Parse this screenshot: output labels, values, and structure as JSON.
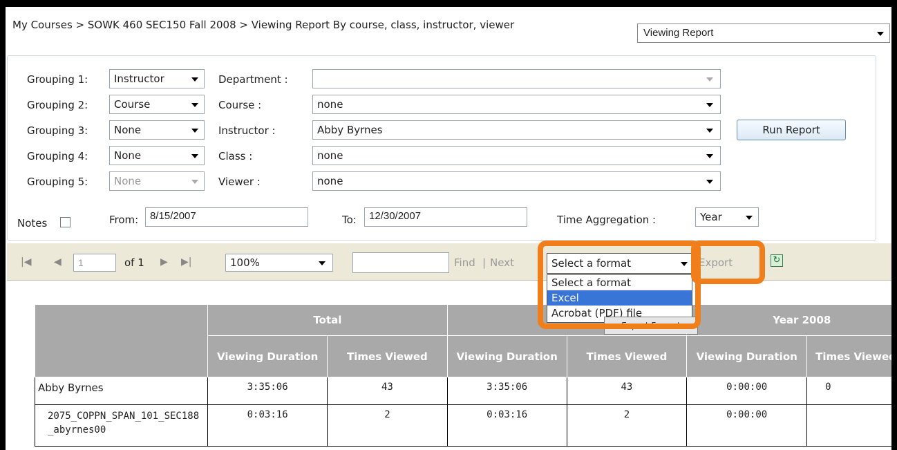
{
  "breadcrumb": "My Courses > SOWK 460 SEC150 Fall 2008 > Viewing Report By course, class, instructor, viewer",
  "report_selector": {
    "value": "Viewing Report"
  },
  "params": {
    "groupings": [
      {
        "label": "Grouping 1:",
        "value": "Instructor"
      },
      {
        "label": "Grouping 2:",
        "value": "Course"
      },
      {
        "label": "Grouping 3:",
        "value": "None"
      },
      {
        "label": "Grouping 4:",
        "value": "None"
      },
      {
        "label": "Grouping 5:",
        "value": "None"
      }
    ],
    "filters": [
      {
        "label": "Department :",
        "value": ""
      },
      {
        "label": "Course :",
        "value": "none"
      },
      {
        "label": "Instructor :",
        "value": "Abby Byrnes"
      },
      {
        "label": "Class :",
        "value": "none"
      },
      {
        "label": "Viewer :",
        "value": "none"
      }
    ],
    "run_report_label": "Run Report",
    "notes_label": "Notes",
    "from_label": "From:",
    "from_value": "8/15/2007",
    "to_label": "To:",
    "to_value": "12/30/2007",
    "time_aggregation_label": "Time Aggregation :",
    "time_aggregation_value": "Year"
  },
  "toolbar": {
    "page_value": "1",
    "of_pages": "of 1",
    "zoom": "100%",
    "find_label": "Find",
    "separator": "|",
    "next_label": "Next",
    "format_select": "Select a format",
    "export_label": "Export",
    "format_options": [
      "Select a format",
      "Excel",
      "Acrobat (PDF) file"
    ],
    "selected_option_index": 1,
    "tooltip": "Export Format"
  },
  "colors": {
    "highlight": "#f07e1b",
    "header_bg": "#a9a9a9",
    "selection": "#3875d7",
    "toolbar_bg": "#ece9d8"
  },
  "table": {
    "groups": [
      "Total",
      "",
      "Year 2008"
    ],
    "subheaders": [
      "Viewing Duration",
      "Times Viewed",
      "Viewing Duration",
      "Times Viewed",
      "Viewing Duration",
      "Times Viewed"
    ],
    "rows": [
      {
        "name": "Abby Byrnes",
        "values": [
          "3:35:06",
          "43",
          "3:35:06",
          "43",
          "0:00:00",
          "0"
        ]
      },
      {
        "name": "2075_COPPN_SPAN_101_SEC188_abyrnes00",
        "values": [
          "0:03:16",
          "2",
          "0:03:16",
          "2",
          "0:00:00",
          ""
        ]
      }
    ]
  }
}
